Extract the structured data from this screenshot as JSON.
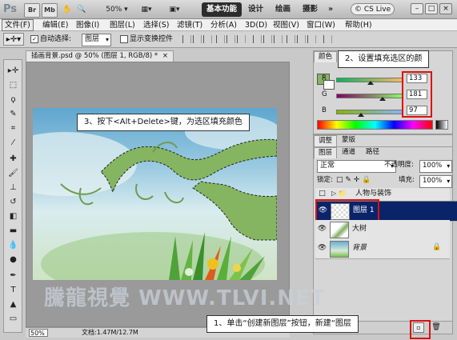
{
  "titlebar": {
    "ps_label": "Ps",
    "br_label": "Br",
    "mb_label": "Mb",
    "zoom": "50%",
    "workspaces": [
      "基本功能",
      "设计",
      "绘画",
      "摄影"
    ],
    "more_label": "»",
    "cslive": "CS Live"
  },
  "menu": [
    "文件(F)",
    "编辑(E)",
    "图像(I)",
    "图层(L)",
    "选择(S)",
    "滤镜(T)",
    "分析(A)",
    "3D(D)",
    "视图(V)",
    "窗口(W)",
    "帮助(H)"
  ],
  "options": {
    "auto_select_label": "自动选择:",
    "auto_select_value": "图层",
    "show_transform_label": "显示变换控件"
  },
  "document": {
    "tab_title": "插画背景.psd @ 50% (图层 1, RGB/8) *",
    "close_glyph": "×",
    "status_zoom": "50%",
    "status_doc": "文档:1.47M/12.7M"
  },
  "color_panel": {
    "tab_color": "颜色",
    "tab_swatches": "色板",
    "foreground_color": "#85b561",
    "r_label": "R",
    "r_value": "133",
    "r_level": 0.52,
    "g_label": "G",
    "g_value": "181",
    "g_level": 0.71,
    "b_label": "B",
    "b_value": "97",
    "b_level": 0.38
  },
  "adjust_tabs": [
    "调整",
    "蒙版"
  ],
  "layers_panel": {
    "tabs": [
      "图层",
      "通道",
      "路径"
    ],
    "blend_mode": "正常",
    "opacity_label": "不透明度:",
    "opacity_value": "100%",
    "lock_label": "锁定:",
    "fill_label": "填充:",
    "fill_value": "100%",
    "layers": [
      {
        "name": "人物与装饰",
        "type": "group",
        "selected": false
      },
      {
        "name": "图层 1",
        "type": "layer",
        "selected": true
      },
      {
        "name": "大树",
        "type": "layer",
        "selected": false
      },
      {
        "name": "背景",
        "type": "background",
        "selected": false
      }
    ]
  },
  "callouts": {
    "step1": "1、单击“创建新图层”按钮，新建“图层",
    "step2": "2、设置填充选区的颜",
    "step3": "3、按下<Alt+Delete>键，为选区填充颜色"
  },
  "watermark": "騰龍視覺 WWW.TLVI.NET",
  "accent_red": "#e01010",
  "selection_blue": "#0a246a"
}
